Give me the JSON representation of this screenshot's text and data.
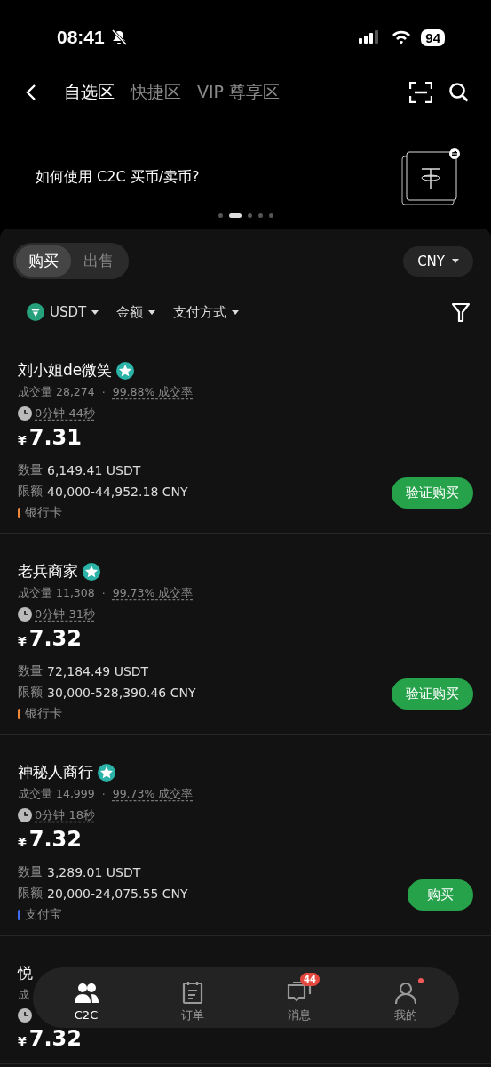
{
  "status_bar": {
    "time": "08:41",
    "battery": "94"
  },
  "tabs": [
    {
      "label": "自选区",
      "selected": true
    },
    {
      "label": "快捷区",
      "selected": false
    },
    {
      "label": "VIP 尊享区",
      "selected": false
    }
  ],
  "banner": {
    "text": "如何使用 C2C 买币/卖币?",
    "pages": [
      {
        "selected": false
      },
      {
        "selected": true
      },
      {
        "selected": false
      },
      {
        "selected": false
      },
      {
        "selected": false
      }
    ]
  },
  "side_toggle": [
    {
      "label": "购买",
      "selected": true
    },
    {
      "label": "出售",
      "selected": false
    }
  ],
  "fiat": "CNY",
  "filters": [
    {
      "kind": "coin",
      "label": "USDT"
    },
    {
      "kind": "plain",
      "label": "金额"
    },
    {
      "kind": "plain",
      "label": "支付方式"
    }
  ],
  "listings": [
    {
      "name": "刘小姐de微笑",
      "volume_label": "成交量",
      "volume": "28,274",
      "separator": "·",
      "rate": "99.88%",
      "rate_label": "成交率",
      "time": "0分钟 44秒",
      "currency": "¥",
      "price": "7.31",
      "qty_label": "数量",
      "qty": "6,149.41 USDT",
      "limit_label": "限额",
      "limit": "40,000-44,952.18 CNY",
      "payment": "银行卡",
      "color": "#f0883a",
      "button": "验证购买"
    },
    {
      "name": "老兵商家",
      "volume_label": "成交量",
      "volume": "11,308",
      "separator": "·",
      "rate": "99.73%",
      "rate_label": "成交率",
      "time": "0分钟 31秒",
      "currency": "¥",
      "price": "7.32",
      "qty_label": "数量",
      "qty": "72,184.49 USDT",
      "limit_label": "限额",
      "limit": "30,000-528,390.46 CNY",
      "payment": "银行卡",
      "color": "#f0883a",
      "button": "验证购买"
    },
    {
      "name": "神秘人商行",
      "volume_label": "成交量",
      "volume": "14,999",
      "separator": "·",
      "rate": "99.73%",
      "rate_label": "成交率",
      "time": "0分钟 18秒",
      "currency": "¥",
      "price": "7.32",
      "qty_label": "数量",
      "qty": "3,289.01 USDT",
      "limit_label": "限额",
      "limit": "20,000-24,075.55 CNY",
      "payment": "支付宝",
      "color": "#3d6cf0",
      "button": "购买"
    },
    {
      "name": "悦",
      "volume_label": "成",
      "currency": "¥",
      "price": "7.32"
    }
  ],
  "bottom_nav": [
    {
      "kind": "people",
      "label": "C2C",
      "selected": true
    },
    {
      "kind": "notes",
      "label": "订单",
      "selected": false
    },
    {
      "kind": "chat",
      "label": "消息",
      "selected": false,
      "badge": "44"
    },
    {
      "kind": "person",
      "label": "我的",
      "selected": false,
      "dot": true
    }
  ]
}
